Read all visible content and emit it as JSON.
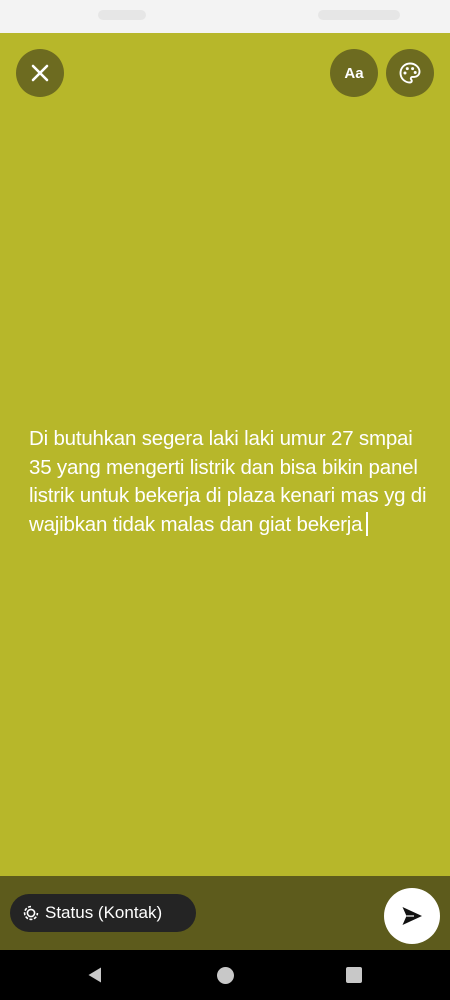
{
  "composer": {
    "status_text": "Di butuhkan segera laki laki umur 27 smpai 35 yang mengerti listrik dan bisa bikin panel listrik untuk bekerja di plaza kenari mas yg di wajibkan tidak malas dan giat bekerja",
    "background_color": "#b7b72a",
    "font_button_label": "Aa",
    "close_icon": "close-icon",
    "palette_icon": "palette-icon"
  },
  "bottom_bar": {
    "audience_label": "Status (Kontak)",
    "audience_icon": "status-icon",
    "send_icon": "send-icon"
  },
  "navigation": {
    "back_icon": "back-triangle-icon",
    "home_icon": "home-circle-icon",
    "recents_icon": "recents-square-icon"
  }
}
